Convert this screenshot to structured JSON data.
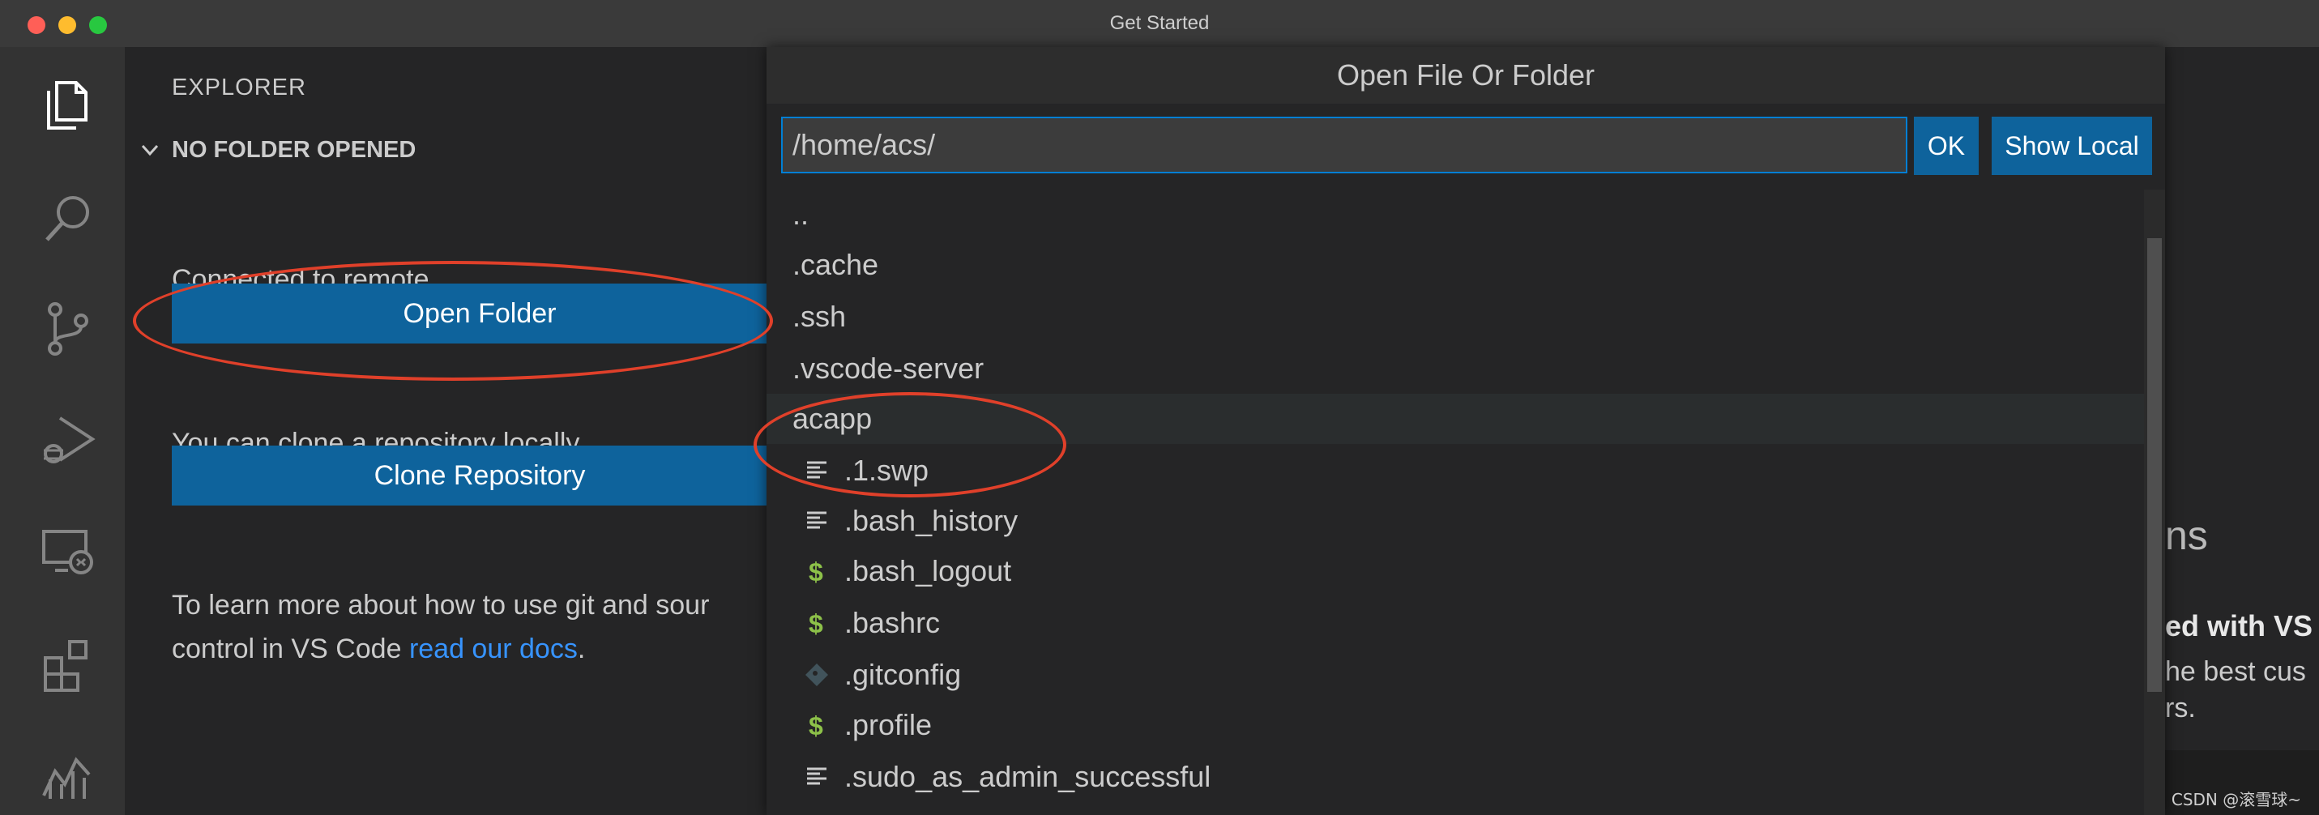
{
  "window": {
    "title": "Get Started",
    "traffic_lights": [
      "#ff5f57",
      "#febc2e",
      "#28c840"
    ]
  },
  "activity_bar": {
    "icons": [
      "explorer-icon",
      "search-icon",
      "source-control-icon",
      "run-debug-icon",
      "remote-explorer-icon",
      "extensions-icon",
      "stats-icon"
    ]
  },
  "sidebar": {
    "title": "EXPLORER",
    "section_title": "NO FOLDER OPENED",
    "connected_text": "Connected to remote.",
    "open_folder_label": "Open Folder",
    "clone_hint": "You can clone a repository locally.",
    "clone_label": "Clone Repository",
    "learn_line1": "To learn more about how to use git and sour",
    "learn_line2_prefix": "control in VS Code ",
    "learn_link": "read our docs",
    "learn_suffix": "."
  },
  "background_fragments": {
    "frag1": "ns",
    "frag2": "ed with VS",
    "frag3": "he best cus",
    "frag4": "rs."
  },
  "quick_open": {
    "title": "Open File Or Folder",
    "path_value": "/home/acs/",
    "ok_label": "OK",
    "show_local_label": "Show Local",
    "items": [
      {
        "label": "..",
        "kind": "folder"
      },
      {
        "label": ".cache",
        "kind": "folder"
      },
      {
        "label": ".ssh",
        "kind": "folder"
      },
      {
        "label": ".vscode-server",
        "kind": "folder"
      },
      {
        "label": "acapp",
        "kind": "folder",
        "active": true
      },
      {
        "label": ".1.swp",
        "kind": "file",
        "icon": "lines-icon"
      },
      {
        "label": ".bash_history",
        "kind": "file",
        "icon": "lines-icon"
      },
      {
        "label": ".bash_logout",
        "kind": "file",
        "icon": "dollar-icon"
      },
      {
        "label": ".bashrc",
        "kind": "file",
        "icon": "dollar-icon"
      },
      {
        "label": ".gitconfig",
        "kind": "file",
        "icon": "git-diamond-icon"
      },
      {
        "label": ".profile",
        "kind": "file",
        "icon": "dollar-icon"
      },
      {
        "label": ".sudo_as_admin_successful",
        "kind": "file",
        "icon": "lines-icon"
      }
    ]
  },
  "colors": {
    "accent": "#0e639c",
    "focus_border": "#007fd4",
    "link": "#3794ff",
    "annotation": "#e0402a",
    "shell_icon": "#8dc149"
  },
  "watermark": "CSDN @滚雪球~"
}
